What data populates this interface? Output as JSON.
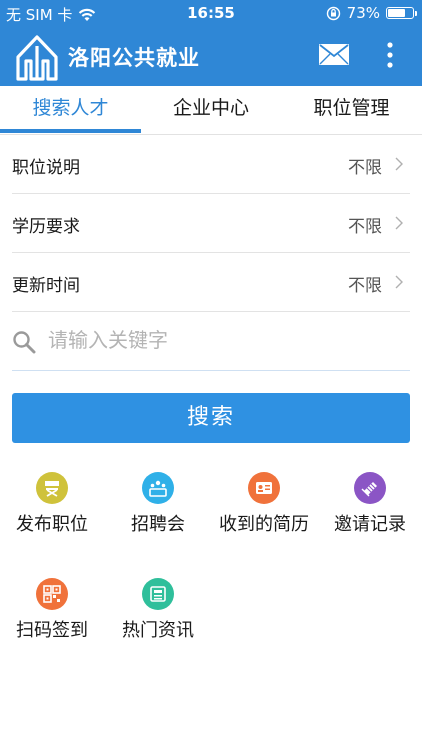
{
  "status_bar": {
    "carrier": "无 SIM 卡",
    "time": "16:55",
    "battery": "73%",
    "battery_level": 0.73
  },
  "header": {
    "title": "洛阳公共就业"
  },
  "tabs": [
    {
      "label": "搜索人才",
      "active": true
    },
    {
      "label": "企业中心",
      "active": false
    },
    {
      "label": "职位管理",
      "active": false
    }
  ],
  "filters": [
    {
      "label": "职位说明",
      "value": "不限"
    },
    {
      "label": "学历要求",
      "value": "不限"
    },
    {
      "label": "更新时间",
      "value": "不限"
    }
  ],
  "search": {
    "placeholder": "请输入关键字",
    "button_label": "搜索"
  },
  "quick_actions": [
    {
      "label": "发布职位",
      "icon": "director-chair-icon",
      "color": "#cfc23b"
    },
    {
      "label": "招聘会",
      "icon": "people-group-icon",
      "color": "#2fb0e8"
    },
    {
      "label": "收到的简历",
      "icon": "id-card-icon",
      "color": "#f0723b"
    },
    {
      "label": "邀请记录",
      "icon": "envelope-stack-icon",
      "color": "#8b55c5"
    },
    {
      "label": "扫码签到",
      "icon": "qr-code-icon",
      "color": "#f0723b"
    },
    {
      "label": "热门资讯",
      "icon": "news-icon",
      "color": "#2fbf9b"
    }
  ],
  "colors": {
    "primary": "#2f87d6",
    "button": "#2f91e2"
  }
}
